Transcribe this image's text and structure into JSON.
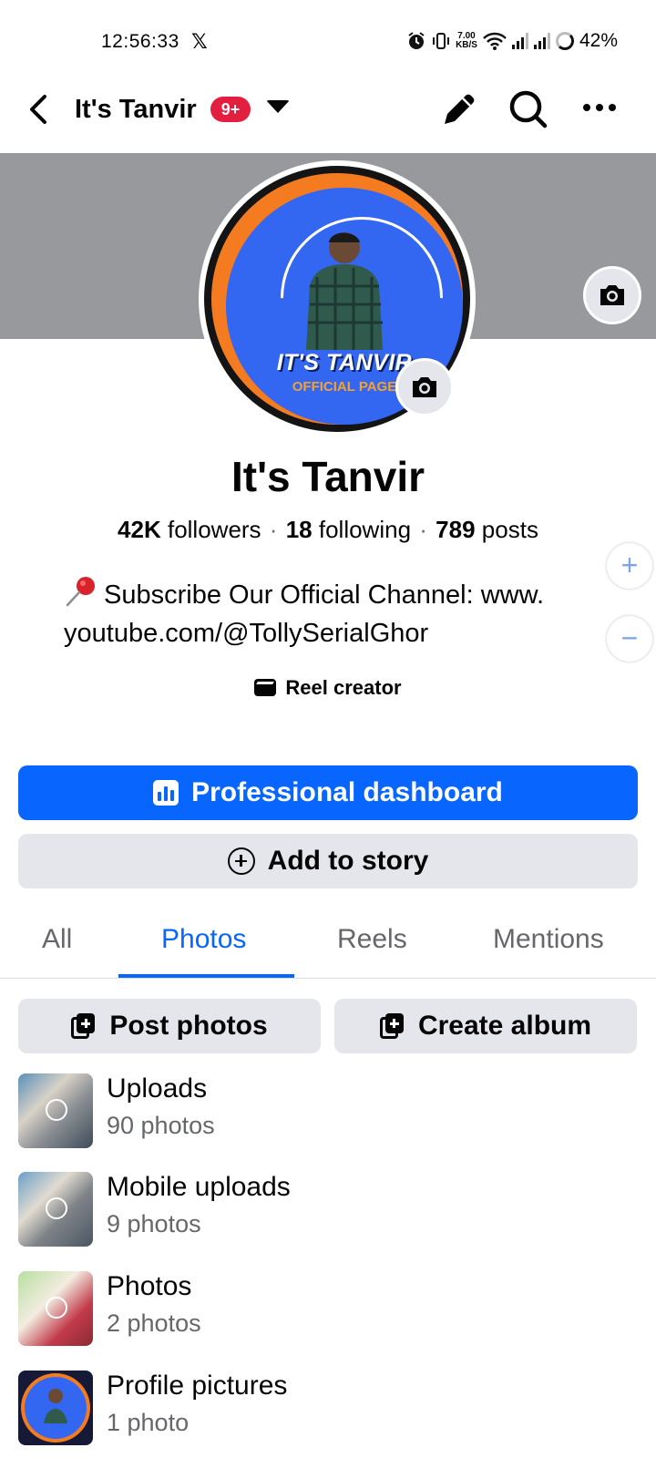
{
  "status_bar": {
    "time": "12:56:33",
    "app_icon": "x-logo-icon",
    "net_speed_value": "7.00",
    "net_speed_unit": "KB/S",
    "battery": "42%"
  },
  "header": {
    "title": "It's Tanvir",
    "badge": "9+",
    "icons": [
      "back-arrow-icon",
      "caret-down-icon",
      "edit-pencil-icon",
      "search-icon",
      "more-icon"
    ]
  },
  "avatar": {
    "title_line": "IT'S TANVIR",
    "sub_line": "OFFICIAL PAGE"
  },
  "profile": {
    "name": "It's Tanvir",
    "followers_count": "42K",
    "followers_label": "followers",
    "following_count": "18",
    "following_label": "following",
    "posts_count": "789",
    "posts_label": "posts",
    "bio": "Subscribe Our Official Channel: www. youtube.com/@TollySerialGhor",
    "category": "Reel creator"
  },
  "actions": {
    "primary": "Professional dashboard",
    "secondary": "Add to story"
  },
  "zoom": {
    "plus": "+",
    "minus": "−"
  },
  "tabs": [
    {
      "label": "All"
    },
    {
      "label": "Photos",
      "active": true
    },
    {
      "label": "Reels"
    },
    {
      "label": "Mentions"
    }
  ],
  "album_actions": {
    "post_photos": "Post photos",
    "create_album": "Create album"
  },
  "albums": [
    {
      "title": "Uploads",
      "count": "90 photos"
    },
    {
      "title": "Mobile uploads",
      "count": "9 photos"
    },
    {
      "title": "Photos",
      "count": "2 photos"
    },
    {
      "title": "Profile pictures",
      "count": "1 photo"
    }
  ],
  "colors": {
    "accent": "#0866ff",
    "badge": "#e41e3f",
    "cover": "#98999c",
    "secondary_button": "#e4e6eb",
    "avatar_blue": "#3367f1",
    "avatar_orange": "#f47b20"
  }
}
